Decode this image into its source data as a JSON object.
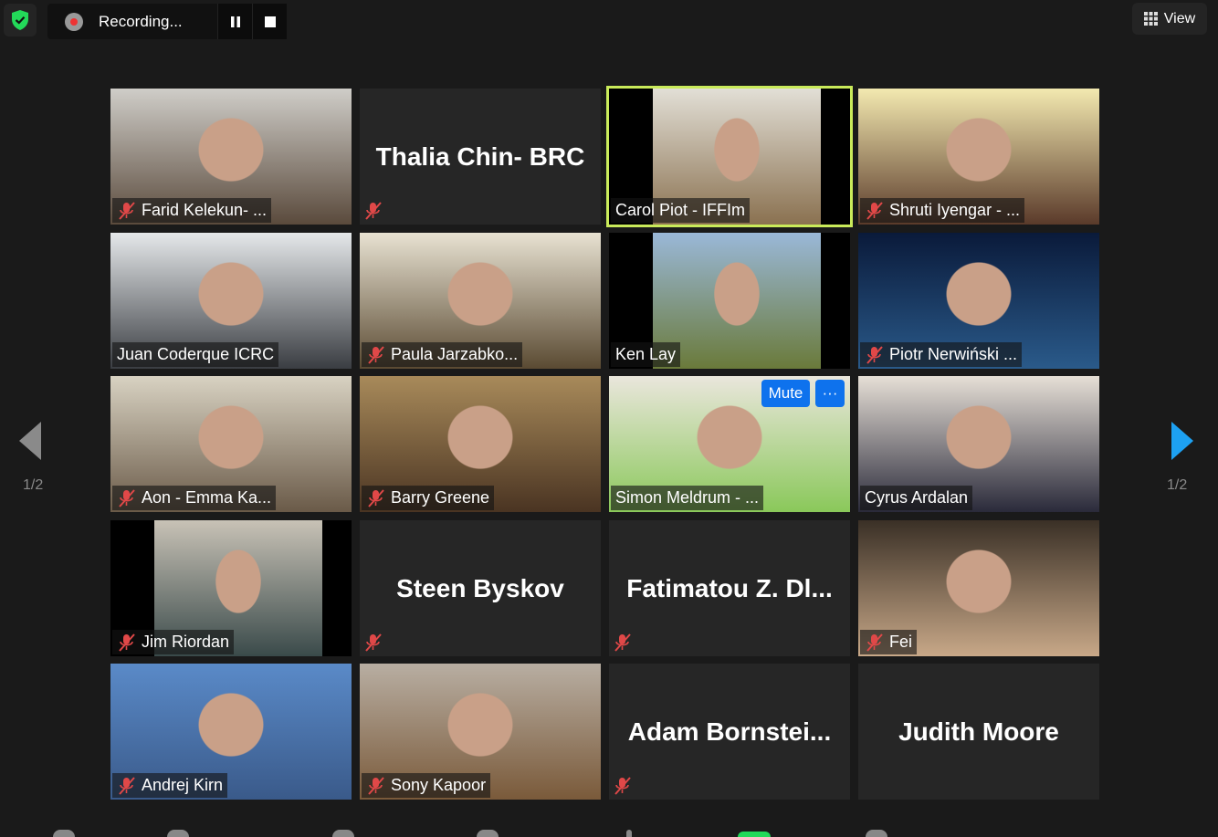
{
  "top": {
    "recording_label": "Recording...",
    "view_label": "View",
    "security_color": "#23d959"
  },
  "pager": {
    "left": "1/2",
    "right": "1/2",
    "accent": "#1da1f2"
  },
  "hover_controls": {
    "mute": "Mute",
    "more": "···"
  },
  "participants": [
    {
      "name": "Farid Kelekun- ...",
      "video": true,
      "muted": true,
      "bg": [
        "#cfcdc8",
        "#5a4a3c"
      ]
    },
    {
      "name": "Thalia Chin- BRC",
      "video": false,
      "muted": true
    },
    {
      "name": "Carol Piot - IFFIm",
      "video": true,
      "muted": false,
      "active": true,
      "bg": [
        "#e2dfd6",
        "#8a7150"
      ],
      "letterbox": true
    },
    {
      "name": "Shruti Iyengar - ...",
      "video": true,
      "muted": true,
      "bg": [
        "#f3e9b0",
        "#5a3a2a"
      ]
    },
    {
      "name": "Juan Coderque ICRC",
      "video": true,
      "muted": false,
      "bg": [
        "#e5e8ea",
        "#3a3d42"
      ]
    },
    {
      "name": "Paula Jarzabko...",
      "video": true,
      "muted": true,
      "bg": [
        "#e8e2d2",
        "#5a4a32"
      ]
    },
    {
      "name": "Ken Lay",
      "video": true,
      "muted": false,
      "bg": [
        "#9ab8d8",
        "#6a7a3a"
      ],
      "letterbox": true
    },
    {
      "name": "Piotr Nerwiński ...",
      "video": true,
      "muted": true,
      "bg": [
        "#0a1a3a",
        "#2a5a8a"
      ]
    },
    {
      "name": "Aon - Emma Ka...",
      "video": true,
      "muted": true,
      "bg": [
        "#d8d2c2",
        "#6a5a48"
      ]
    },
    {
      "name": "Barry Greene",
      "video": true,
      "muted": true,
      "bg": [
        "#a88a5a",
        "#4a3422"
      ]
    },
    {
      "name": "Simon Meldrum - ...",
      "video": true,
      "muted": false,
      "hovered": true,
      "bg": [
        "#eae6dc",
        "#8ac85a"
      ]
    },
    {
      "name": "Cyrus Ardalan",
      "video": true,
      "muted": false,
      "bg": [
        "#e6dfd6",
        "#2a2a3a"
      ]
    },
    {
      "name": "Jim Riordan",
      "video": true,
      "muted": true,
      "bg": [
        "#c8c2b6",
        "#3a4a4a"
      ],
      "letterbox": true
    },
    {
      "name": "Steen Byskov",
      "video": false,
      "muted": true
    },
    {
      "name": "Fatimatou  Z. Dl...",
      "video": false,
      "muted": true
    },
    {
      "name": "Fei",
      "video": true,
      "muted": true,
      "bg": [
        "#3a3026",
        "#c8a888"
      ]
    },
    {
      "name": "Andrej Kirn",
      "video": true,
      "muted": true,
      "bg": [
        "#5a8ac8",
        "#3a5a8a"
      ]
    },
    {
      "name": "Sony Kapoor",
      "video": true,
      "muted": true,
      "bg": [
        "#b8aea2",
        "#7a5a3a"
      ]
    },
    {
      "name": "Adam  Bornstei...",
      "video": false,
      "muted": true
    },
    {
      "name": "Judith Moore",
      "video": false,
      "muted": false
    }
  ]
}
